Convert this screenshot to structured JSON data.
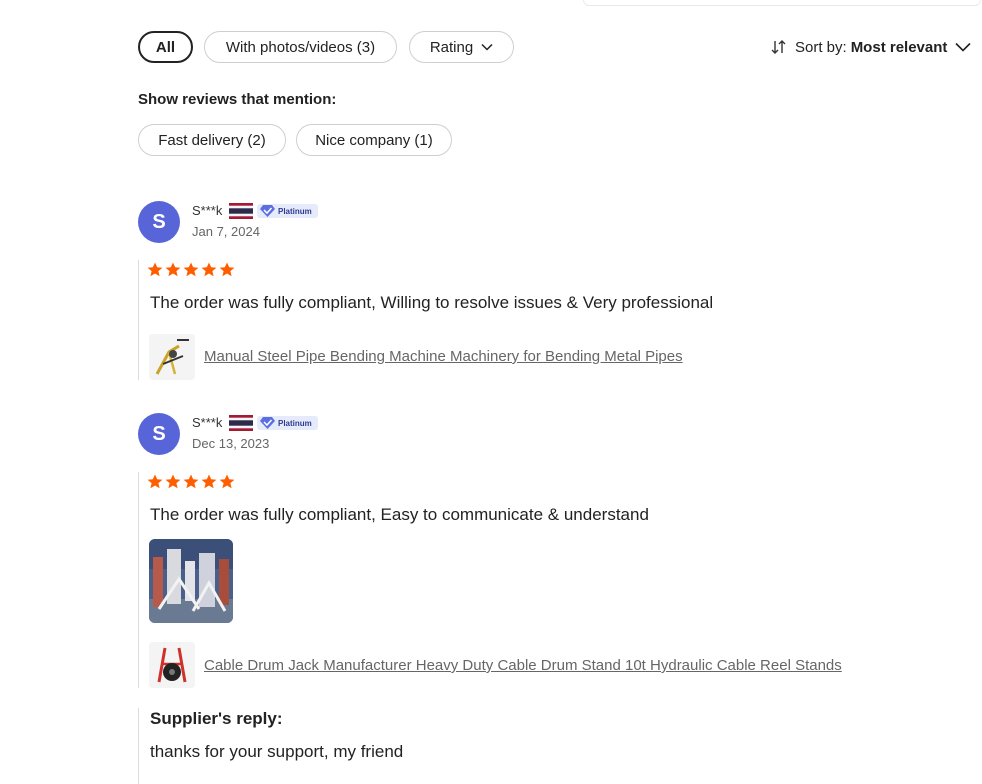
{
  "filters": {
    "all": "All",
    "photos": "With photos/videos (3)",
    "rating": "Rating"
  },
  "sort": {
    "label": "Sort by:",
    "value": "Most relevant"
  },
  "mentions": {
    "title": "Show reviews that mention:",
    "tags": [
      "Fast delivery (2)",
      "Nice company (1)"
    ]
  },
  "reviews": [
    {
      "avatar": "S",
      "name": "S***k",
      "badge": "Platinum",
      "date": "Jan 7, 2024",
      "rating": 5,
      "text": "The order was fully compliant, Willing to resolve issues & Very professional",
      "product": "Manual Steel Pipe Bending Machine Machinery for Bending Metal Pipes"
    },
    {
      "avatar": "S",
      "name": "S***k",
      "badge": "Platinum",
      "date": "Dec 13, 2023",
      "rating": 5,
      "text": "The order was fully compliant, Easy to communicate & understand",
      "product": "Cable Drum Jack Manufacturer Heavy Duty Cable Drum Stand 10t Hydraulic Cable Reel Stands"
    }
  ],
  "reply": {
    "title": "Supplier's reply:",
    "text": "thanks for your support, my friend"
  },
  "colors": {
    "avatar": "#5865d8",
    "star": "#ff5e00",
    "badge_bg": "#e6ebfb"
  }
}
